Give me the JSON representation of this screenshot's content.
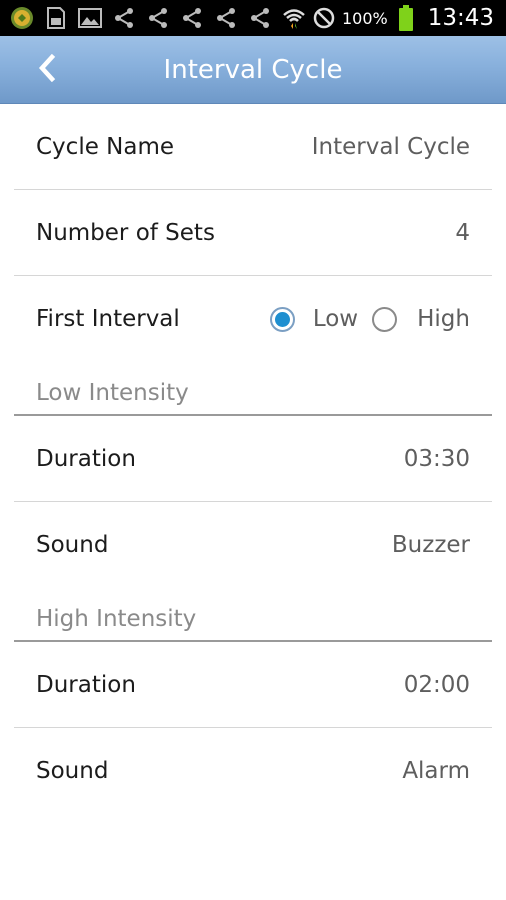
{
  "status_bar": {
    "icons": [
      "app-icon",
      "sd-card-icon",
      "image-icon",
      "share-icon",
      "share-icon",
      "share-icon",
      "share-icon",
      "share-icon"
    ],
    "wifi_icon": "wifi-icon",
    "no_signal_icon": "no-signal-icon",
    "battery_text": "100%",
    "battery_icon": "battery-icon",
    "time": "13:43"
  },
  "header": {
    "title": "Interval Cycle",
    "back_icon": "chevron-left-icon"
  },
  "settings": {
    "cycle_name": {
      "label": "Cycle Name",
      "value": "Interval Cycle"
    },
    "number_of_sets": {
      "label": "Number of Sets",
      "value": "4"
    },
    "first_interval": {
      "label": "First Interval",
      "options": [
        {
          "label": "Low",
          "selected": true
        },
        {
          "label": "High",
          "selected": false
        }
      ]
    }
  },
  "low_intensity": {
    "title": "Low Intensity",
    "duration": {
      "label": "Duration",
      "value": "03:30"
    },
    "sound": {
      "label": "Sound",
      "value": "Buzzer"
    }
  },
  "high_intensity": {
    "title": "High Intensity",
    "duration": {
      "label": "Duration",
      "value": "02:00"
    },
    "sound": {
      "label": "Sound",
      "value": "Alarm"
    }
  },
  "colors": {
    "header_gradient_top": "#9dc0e6",
    "header_gradient_bottom": "#6f99c9",
    "radio_selected": "#1f8fd0",
    "battery": "#7fd21a"
  }
}
